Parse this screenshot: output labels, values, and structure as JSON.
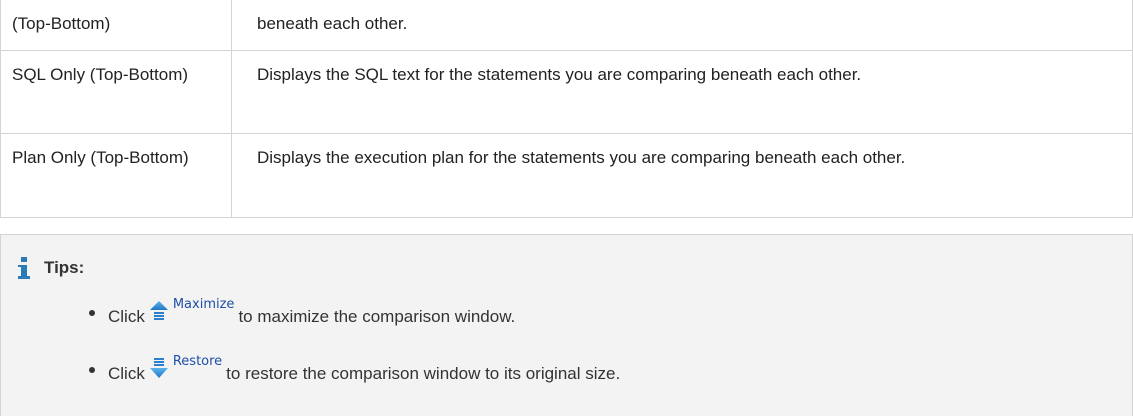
{
  "options_table": {
    "rows": [
      {
        "option": "(Top-Bottom)",
        "description": "beneath each other."
      },
      {
        "option": "SQL Only (Top-Bottom)",
        "description": "Displays the SQL text for the statements you are comparing beneath each other."
      },
      {
        "option": "Plan Only (Top-Bottom)",
        "description": "Displays the execution plan for the statements you are comparing beneath each other."
      }
    ]
  },
  "tips": {
    "icon": "info-icon",
    "title": "Tips:",
    "items": [
      {
        "prefix": "Click",
        "button_icon": "maximize-arrow-icon",
        "button_label": "Maximize",
        "suffix": "to maximize the comparison window."
      },
      {
        "prefix": "Click",
        "button_icon": "restore-arrow-icon",
        "button_label": "Restore",
        "suffix": "to restore the comparison window to its original size."
      }
    ]
  },
  "colors": {
    "border": "#d4d4d4",
    "tips_background": "#f3f3f3",
    "info_icon": "#2a7ab8",
    "button_label": "#1f4fa8"
  }
}
